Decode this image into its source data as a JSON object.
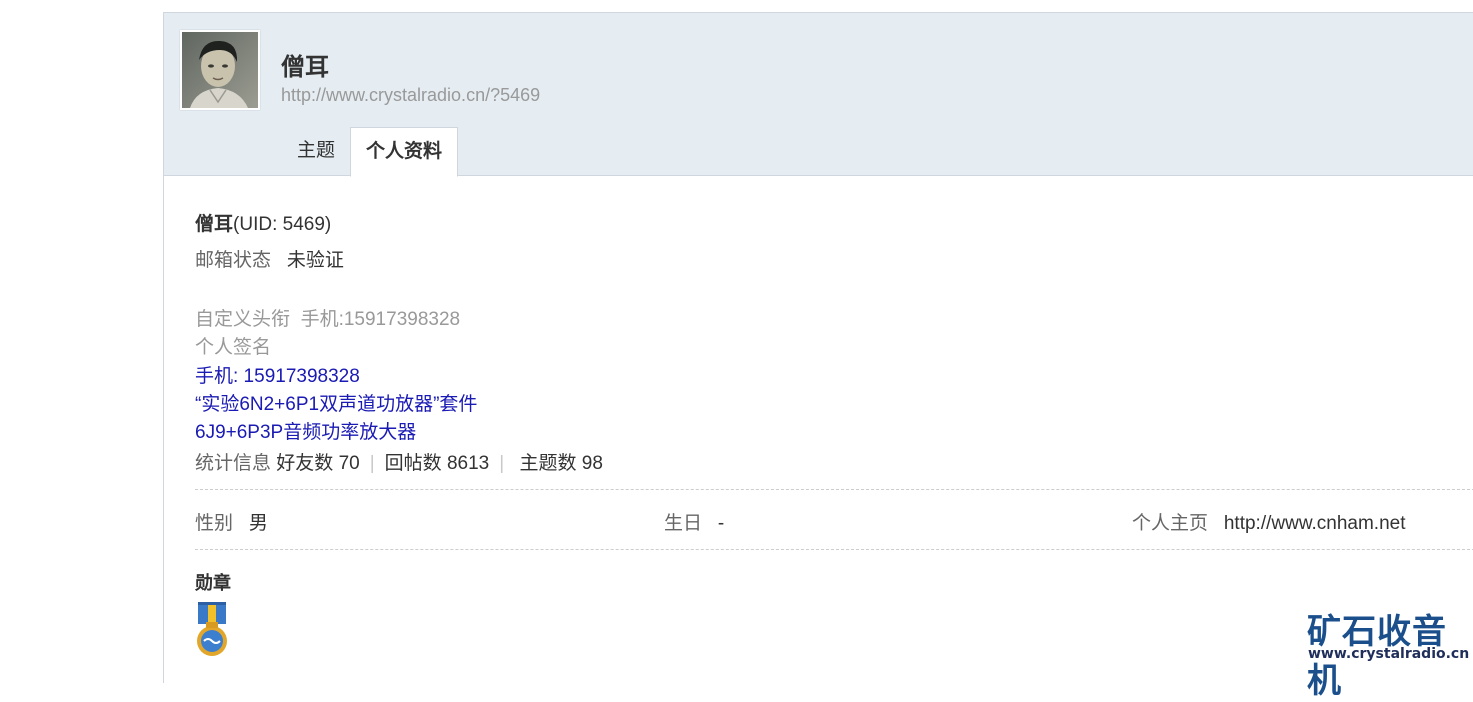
{
  "profile": {
    "name": "僧耳",
    "url": "http://www.crystalradio.cn/?5469"
  },
  "tabs": [
    {
      "label": "主题",
      "active": false
    },
    {
      "label": "个人资料",
      "active": true
    }
  ],
  "info": {
    "name": "僧耳",
    "uid_text": "(UID: 5469)",
    "email_label": "邮箱状态",
    "email_value": "未验证",
    "title_label": "自定义头衔",
    "title_value": "手机:15917398328",
    "signature_label": "个人签名",
    "signature_lines": [
      "手机: 15917398328",
      "“实验6N2+6P1双声道功放器”套件",
      "6J9+6P3P音频功率放大器"
    ],
    "stats_label": "统计信息",
    "stats": [
      {
        "label": "好友数",
        "value": "70"
      },
      {
        "label": "回帖数",
        "value": "8613"
      },
      {
        "label": "主题数",
        "value": "98"
      }
    ],
    "gender_label": "性别",
    "gender_value": "男",
    "birthday_label": "生日",
    "birthday_value": "-",
    "homepage_label": "个人主页",
    "homepage_value": "http://www.cnham.net",
    "medals_label": "勋章"
  },
  "logo": {
    "name": "矿石收音机",
    "url": "www.crystalradio.cn"
  },
  "colors": {
    "header_bg": "#e5edf2",
    "border": "#cfd6de",
    "link_blue": "#1a1ab4",
    "logo_blue": "#1a4f8c"
  }
}
